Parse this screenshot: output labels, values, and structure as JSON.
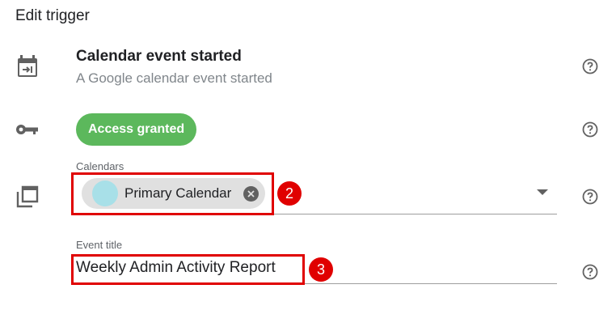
{
  "header": {
    "title": "Edit trigger"
  },
  "trigger": {
    "name": "Calendar event started",
    "description": "A Google calendar event started"
  },
  "access": {
    "badge_label": "Access granted",
    "badge_color": "#5cb85c"
  },
  "calendars": {
    "label": "Calendars",
    "chips": [
      {
        "label": "Primary Calendar",
        "avatar_color": "#a8e0e8"
      }
    ]
  },
  "event_title": {
    "label": "Event title",
    "value": "Weekly Admin Activity Report"
  },
  "annotations": [
    {
      "number": "2"
    },
    {
      "number": "3"
    }
  ],
  "colors": {
    "annotation_red": "#e00000",
    "muted_text": "#80868b"
  },
  "icons": [
    "calendar-trigger-icon",
    "key-icon",
    "calendar-stack-icon",
    "help-icon",
    "chip-remove-icon",
    "dropdown-arrow-icon"
  ]
}
